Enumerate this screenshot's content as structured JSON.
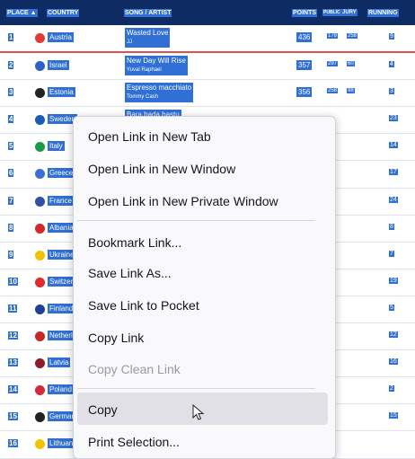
{
  "header": {
    "place": "PLACE ▲",
    "country": "COUNTRY",
    "song": "SONG / ARTIST",
    "points": "POINTS",
    "public": "PUBLIC",
    "jury": "JURY",
    "running": "RUNNING"
  },
  "rows": [
    {
      "num": "1",
      "country": "Austria",
      "flag_color": "#e23a3a",
      "song": "Wasted Love",
      "artist": "JJ",
      "pts": "436",
      "pub": "178",
      "jury": "258",
      "run": "9"
    },
    {
      "num": "2",
      "country": "Israel",
      "flag_color": "#2f5fc9",
      "song": "New Day Will Rise",
      "artist": "Yuval Raphael",
      "pts": "357",
      "pub": "297",
      "jury": "60",
      "run": "4"
    },
    {
      "num": "3",
      "country": "Estonia",
      "flag_color": "#222222",
      "song": "Espresso macchiato",
      "artist": "Tommy Cash",
      "pts": "356",
      "pub": "258",
      "jury": "98",
      "run": "3"
    },
    {
      "num": "4",
      "country": "Sweden",
      "flag_color": "#1e5bb5",
      "song": "Bara bada bastu",
      "artist": "",
      "pts": "",
      "pub": "",
      "jury": "",
      "run": "23"
    },
    {
      "num": "5",
      "country": "Italy",
      "flag_color": "#1a9a4a",
      "song": "",
      "artist": "",
      "pts": "",
      "pub": "",
      "jury": "",
      "run": "14"
    },
    {
      "num": "6",
      "country": "Greece",
      "flag_color": "#3b6fd4",
      "song": "",
      "artist": "",
      "pts": "",
      "pub": "",
      "jury": "",
      "run": "17"
    },
    {
      "num": "7",
      "country": "France",
      "flag_color": "#2f4fa8",
      "song": "",
      "artist": "",
      "pts": "",
      "pub": "",
      "jury": "",
      "run": "24"
    },
    {
      "num": "8",
      "country": "Albania",
      "flag_color": "#d62828",
      "song": "",
      "artist": "",
      "pts": "",
      "pub": "",
      "jury": "",
      "run": "8"
    },
    {
      "num": "9",
      "country": "Ukraine",
      "flag_color": "#f2c200",
      "song": "",
      "artist": "",
      "pts": "",
      "pub": "",
      "jury": "",
      "run": "7"
    },
    {
      "num": "10",
      "country": "Switzerland",
      "flag_color": "#e02b2b",
      "song": "",
      "artist": "",
      "pts": "",
      "pub": "",
      "jury": "",
      "run": "19"
    },
    {
      "num": "11",
      "country": "Finland",
      "flag_color": "#1c3f9a",
      "song": "",
      "artist": "",
      "pts": "",
      "pub": "",
      "jury": "",
      "run": "5"
    },
    {
      "num": "12",
      "country": "Netherlands",
      "flag_color": "#c62828",
      "song": "",
      "artist": "",
      "pts": "",
      "pub": "",
      "jury": "",
      "run": "12"
    },
    {
      "num": "13",
      "country": "Latvia",
      "flag_color": "#8c1c28",
      "song": "",
      "artist": "",
      "pts": "",
      "pub": "",
      "jury": "",
      "run": "16"
    },
    {
      "num": "14",
      "country": "Poland",
      "flag_color": "#d8283c",
      "song": "",
      "artist": "",
      "pts": "",
      "pub": "",
      "jury": "",
      "run": "2"
    },
    {
      "num": "15",
      "country": "Germany",
      "flag_color": "#222222",
      "song": "",
      "artist": "",
      "pts": "",
      "pub": "",
      "jury": "",
      "run": "15"
    },
    {
      "num": "16",
      "country": "Lithuania",
      "flag_color": "#f2c200",
      "song": "",
      "artist": "",
      "pts": "",
      "pub": "",
      "jury": "",
      "run": ""
    }
  ],
  "menu": {
    "open_tab": "Open Link in New Tab",
    "open_window": "Open Link in New Window",
    "open_private": "Open Link in New Private Window",
    "bookmark": "Bookmark Link...",
    "save_as": "Save Link As...",
    "save_pocket": "Save Link to Pocket",
    "copy_link": "Copy Link",
    "copy_clean": "Copy Clean Link",
    "copy": "Copy",
    "print_selection": "Print Selection..."
  }
}
